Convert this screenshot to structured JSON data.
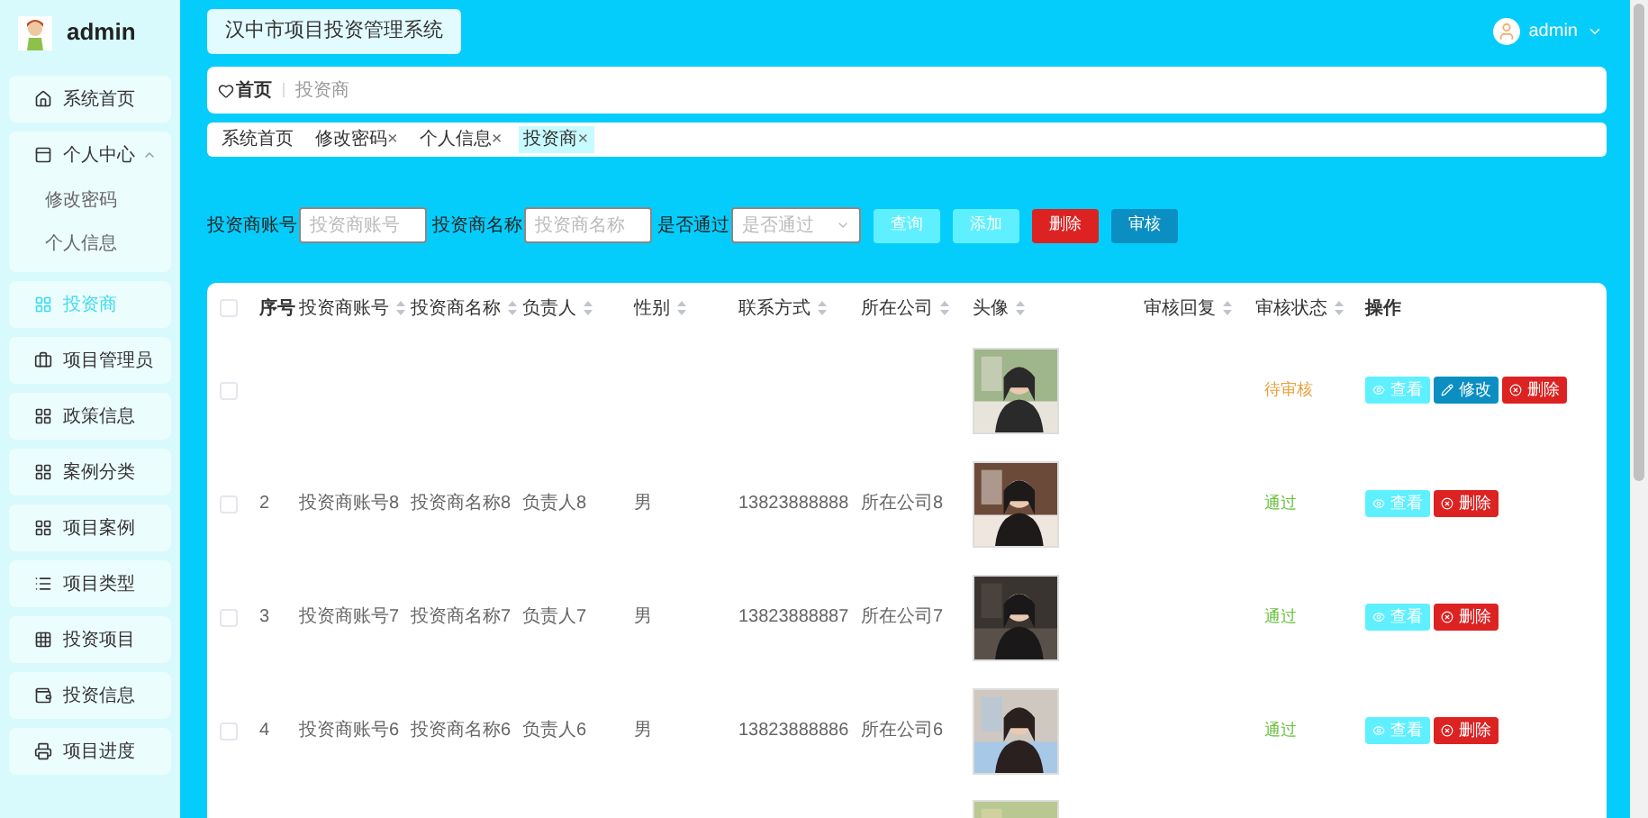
{
  "sidebar": {
    "user": "admin",
    "items": [
      {
        "label": "系统首页",
        "selected": false
      },
      {
        "label": "个人中心",
        "selected": false,
        "expanded": true,
        "children": [
          {
            "label": "修改密码"
          },
          {
            "label": "个人信息"
          }
        ]
      },
      {
        "label": "投资商",
        "selected": true
      },
      {
        "label": "项目管理员",
        "selected": false
      },
      {
        "label": "政策信息",
        "selected": false
      },
      {
        "label": "案例分类",
        "selected": false
      },
      {
        "label": "项目案例",
        "selected": false
      },
      {
        "label": "项目类型",
        "selected": false
      },
      {
        "label": "投资项目",
        "selected": false
      },
      {
        "label": "投资信息",
        "selected": false
      },
      {
        "label": "项目进度",
        "selected": false
      }
    ]
  },
  "header": {
    "title": "汉中市项目投资管理系统",
    "user": "admin"
  },
  "breadcrumb": {
    "home": "首页",
    "current": "投资商"
  },
  "tags": [
    {
      "label": "系统首页",
      "selected": false
    },
    {
      "label": "修改密码",
      "close": "×",
      "selected": false
    },
    {
      "label": "个人信息",
      "close": "×",
      "selected": false
    },
    {
      "label": "投资商",
      "close": "×",
      "selected": true
    }
  ],
  "search": {
    "fields": [
      {
        "kind": "input",
        "label": "投资商账号",
        "placeholder": "投资商账号"
      },
      {
        "kind": "input",
        "label": "投资商名称",
        "placeholder": "投资商名称"
      },
      {
        "kind": "select",
        "label": "是否通过",
        "placeholder": "是否通过"
      }
    ],
    "buttons": [
      {
        "kind": "query",
        "label": "查询"
      },
      {
        "kind": "add",
        "label": "添加"
      },
      {
        "kind": "delete",
        "label": "删除"
      },
      {
        "kind": "audit",
        "label": "审核"
      }
    ]
  },
  "table": {
    "checked": false,
    "columns": [
      {
        "label": "序号",
        "sortable": false
      },
      {
        "label": "投资商账号",
        "sortable": true
      },
      {
        "label": "投资商名称",
        "sortable": true
      },
      {
        "label": "负责人",
        "sortable": true
      },
      {
        "label": "性别",
        "sortable": true
      },
      {
        "label": "联系方式",
        "sortable": true
      },
      {
        "label": "所在公司",
        "sortable": true
      },
      {
        "label": "头像",
        "sortable": true
      },
      {
        "label": "审核回复",
        "sortable": true
      },
      {
        "label": "审核状态",
        "sortable": true
      },
      {
        "label": "操作",
        "sortable": false
      }
    ],
    "rows": [
      {
        "kind": "full",
        "checked": false,
        "status": {
          "text": "待审核",
          "color": "#e6a23c"
        },
        "actions": [
          {
            "kind": "view",
            "label": "查看"
          },
          {
            "kind": "edit",
            "label": "修改"
          },
          {
            "kind": "delete",
            "label": "删除"
          }
        ]
      },
      {
        "kind": "full",
        "checked": false,
        "cells": [
          "2",
          "投资商账号8",
          "投资商名称8",
          "负责人8",
          "男",
          "13823888888",
          "所在公司8"
        ],
        "status": {
          "text": "通过",
          "color": "#67c23a"
        },
        "actions": [
          {
            "kind": "view",
            "label": "查看"
          },
          {
            "kind": "delete",
            "label": "删除"
          }
        ]
      },
      {
        "kind": "full",
        "checked": false,
        "cells": [
          "3",
          "投资商账号7",
          "投资商名称7",
          "负责人7",
          "男",
          "13823888887",
          "所在公司7"
        ],
        "status": {
          "text": "通过",
          "color": "#67c23a"
        },
        "actions": [
          {
            "kind": "view",
            "label": "查看"
          },
          {
            "kind": "delete",
            "label": "删除"
          }
        ]
      },
      {
        "kind": "full",
        "checked": false,
        "cells": [
          "4",
          "投资商账号6",
          "投资商名称6",
          "负责人6",
          "男",
          "13823888886",
          "所在公司6"
        ],
        "status": {
          "text": "通过",
          "color": "#67c23a"
        },
        "actions": [
          {
            "kind": "view",
            "label": "查看"
          },
          {
            "kind": "delete",
            "label": "删除"
          }
        ]
      },
      {
        "kind": "partial"
      }
    ]
  }
}
